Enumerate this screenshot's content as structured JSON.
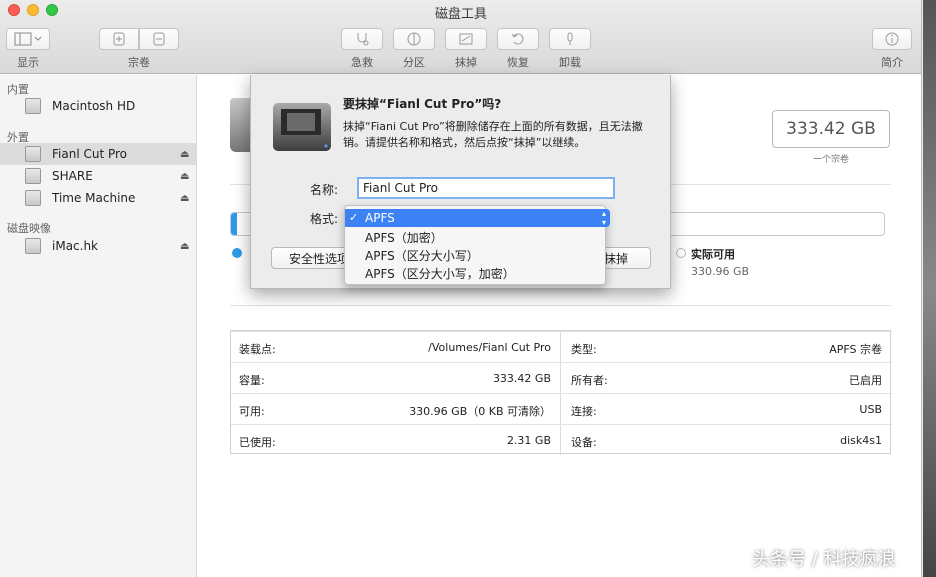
{
  "window": {
    "title": "磁盘工具"
  },
  "toolbar": {
    "view_label": "显示",
    "volume_label": "宗卷",
    "firstaid_label": "急救",
    "partition_label": "分区",
    "erase_label": "抹掉",
    "restore_label": "恢复",
    "unmount_label": "卸载",
    "info_label": "简介"
  },
  "sidebar": {
    "internal_header": "内置",
    "internal": [
      {
        "label": "Macintosh HD"
      }
    ],
    "external_header": "外置",
    "external": [
      {
        "label": "Fianl Cut Pro"
      },
      {
        "label": "SHARE"
      },
      {
        "label": "Time Machine"
      }
    ],
    "images_header": "磁盘映像",
    "images": [
      {
        "label": "iMac.hk"
      }
    ]
  },
  "main": {
    "capacity": "333.42 GB",
    "capacity_sub": "一个宗卷",
    "free_label": "实际可用",
    "free_value": "330.96 GB",
    "info": {
      "left": [
        {
          "k": "装载点:",
          "v": "/Volumes/Fianl Cut Pro"
        },
        {
          "k": "容量:",
          "v": "333.42 GB"
        },
        {
          "k": "可用:",
          "v": "330.96 GB（0 KB 可清除）"
        },
        {
          "k": "已使用:",
          "v": "2.31 GB"
        }
      ],
      "right": [
        {
          "k": "类型:",
          "v": "APFS 宗卷"
        },
        {
          "k": "所有者:",
          "v": "已启用"
        },
        {
          "k": "连接:",
          "v": "USB"
        },
        {
          "k": "设备:",
          "v": "disk4s1"
        }
      ]
    }
  },
  "sheet": {
    "title": "要抹掉“Fianl Cut Pro”吗?",
    "body": "抹掉“Fiani Cut Pro”将删除储存在上面的所有数据，且无法撤销。请提供名称和格式，然后点按“抹掉”以继续。",
    "name_label": "名称:",
    "name_value": "Fianl Cut Pro",
    "format_label": "格式:",
    "format_options": [
      {
        "label": "APFS",
        "selected": true
      },
      {
        "label": "APFS（加密）",
        "selected": false
      },
      {
        "label": "APFS（区分大小写）",
        "selected": false
      },
      {
        "label": "APFS（区分大小写，加密）",
        "selected": false
      }
    ],
    "check_mark": "✓",
    "security_button": "安全性选项",
    "erase_button": "抹掉"
  },
  "watermark": "头条号 / 科技疯浪",
  "colors": {
    "accent": "#3d82f4",
    "used": "#2e9be8"
  }
}
